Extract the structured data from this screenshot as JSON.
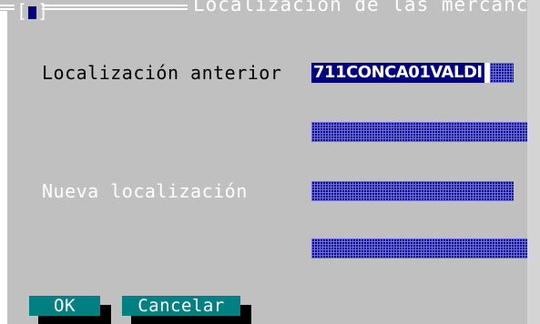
{
  "window": {
    "title": "Localización de las mercancías",
    "close_glyph_left": "[",
    "close_glyph_right": "]"
  },
  "form": {
    "prev_location_label": "Localización anterior",
    "prev_location_value": "711CONCA01VALDI",
    "new_location_label": "Nueva localización"
  },
  "buttons": {
    "ok_label": "OK",
    "cancel_label": "Cancelar"
  },
  "colors": {
    "background": "#c0c0c0",
    "field_bg": "#000080",
    "button_bg": "#008080",
    "text_light": "#ffffff",
    "text_dark": "#000000"
  }
}
